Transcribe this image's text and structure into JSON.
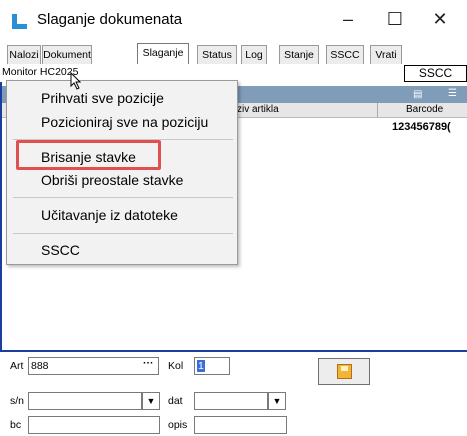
{
  "window": {
    "title": "Slaganje dokumenata",
    "minimize": "–",
    "maximize": "☐",
    "close": "✕"
  },
  "tabs": [
    {
      "label": "Nalozi"
    },
    {
      "label": "Dokument"
    },
    {
      "label": "Slaganje",
      "active": true
    },
    {
      "label": "Status"
    },
    {
      "label": "Log"
    },
    {
      "label": "Stanje"
    },
    {
      "label": "SSCC"
    },
    {
      "label": "Vrati"
    }
  ],
  "monitor_label": "Monitor HC2025",
  "sscc_box": "SSCC",
  "grid": {
    "col_naziv": "ziv artikla",
    "col_barcode": "Barcode",
    "barcode_value": "123456789("
  },
  "context_menu": {
    "items": [
      "Prihvati sve pozicije",
      "Pozicioniraj sve na poziciju",
      "Brisanje stavke",
      "Obriši preostale stavke",
      "Učitavanje iz datoteke",
      "SSCC"
    ],
    "highlighted": "Brisanje stavke"
  },
  "form": {
    "art_label": "Art",
    "art_value": "888",
    "art_btn": "···",
    "kol_label": "Kol",
    "kol_value": "1",
    "sn_label": "s/n",
    "dat_label": "dat",
    "bc_label": "bc",
    "opis_label": "opis"
  },
  "colors": {
    "accent_border": "#1a3f9f",
    "header_bar": "#7f9db9",
    "highlight": "#e05050"
  }
}
